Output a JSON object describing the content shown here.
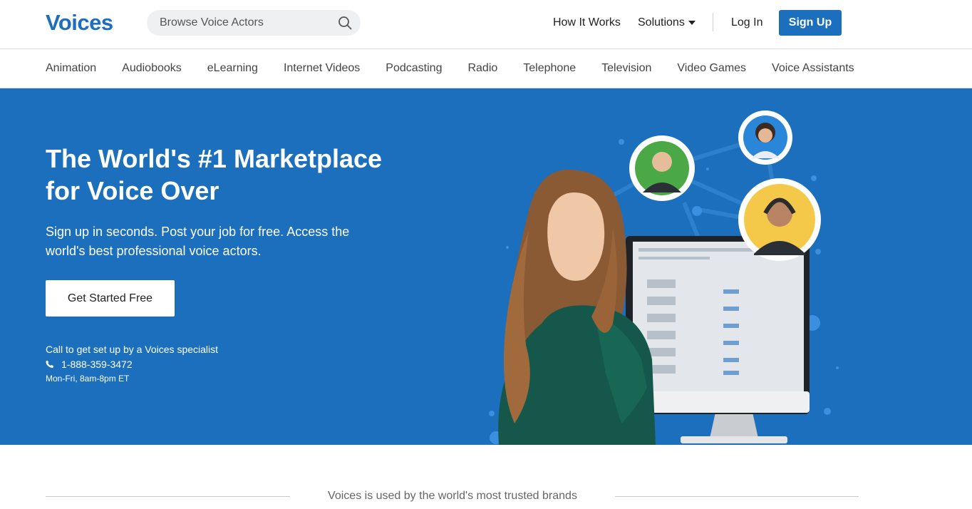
{
  "header": {
    "logo": "Voices",
    "search_placeholder": "Browse Voice Actors",
    "nav": {
      "how_it_works": "How It Works",
      "solutions": "Solutions",
      "log_in": "Log In",
      "sign_up": "Sign Up"
    }
  },
  "categories": [
    "Animation",
    "Audiobooks",
    "eLearning",
    "Internet Videos",
    "Podcasting",
    "Radio",
    "Telephone",
    "Television",
    "Video Games",
    "Voice Assistants"
  ],
  "hero": {
    "title_line1": "The World's #1 Marketplace",
    "title_line2": "for Voice Over",
    "subtitle": "Sign up in seconds. Post your job for free. Access the world's best professional voice actors.",
    "cta": "Get Started Free",
    "call_text": "Call to get set up by a Voices specialist",
    "phone": "1-888-359-3472",
    "hours": "Mon-Fri, 8am-8pm ET"
  },
  "brands": {
    "caption": "Voices is used by the world's most trusted brands"
  },
  "colors": {
    "brand_blue": "#1b6fbd",
    "white": "#ffffff"
  },
  "icons": [
    "search-icon",
    "caret-down-icon",
    "phone-icon"
  ]
}
